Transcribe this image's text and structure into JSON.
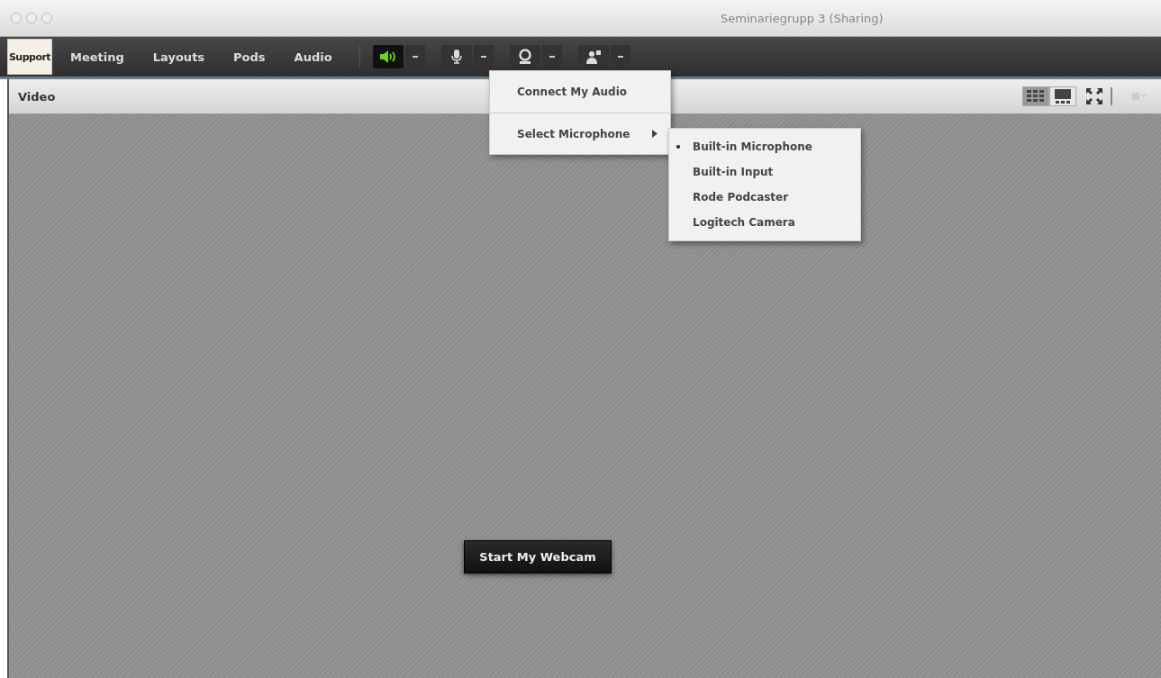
{
  "window": {
    "title": "Seminariegrupp 3 (Sharing)"
  },
  "toolbar": {
    "logo": "Support",
    "menus": [
      "Meeting",
      "Layouts",
      "Pods",
      "Audio"
    ],
    "devices": [
      {
        "kind": "speaker",
        "on": true
      },
      {
        "kind": "microphone",
        "on": false
      },
      {
        "kind": "camera",
        "on": false
      },
      {
        "kind": "presenter",
        "on": false
      }
    ]
  },
  "pod": {
    "title": "Video",
    "views": [
      {
        "kind": "grid",
        "selected": true
      },
      {
        "kind": "filmstrip",
        "selected": false
      }
    ]
  },
  "audio_menu": {
    "items": [
      {
        "label": "Connect My Audio",
        "has_submenu": false
      },
      {
        "label": "Select Microphone",
        "has_submenu": true
      }
    ]
  },
  "microphone_menu": {
    "items": [
      {
        "label": "Built-in Microphone",
        "selected": true
      },
      {
        "label": "Built-in Input",
        "selected": false
      },
      {
        "label": "Rode Podcaster",
        "selected": false
      },
      {
        "label": "Logitech Camera",
        "selected": false
      }
    ]
  },
  "webcam_button": "Start My Webcam"
}
